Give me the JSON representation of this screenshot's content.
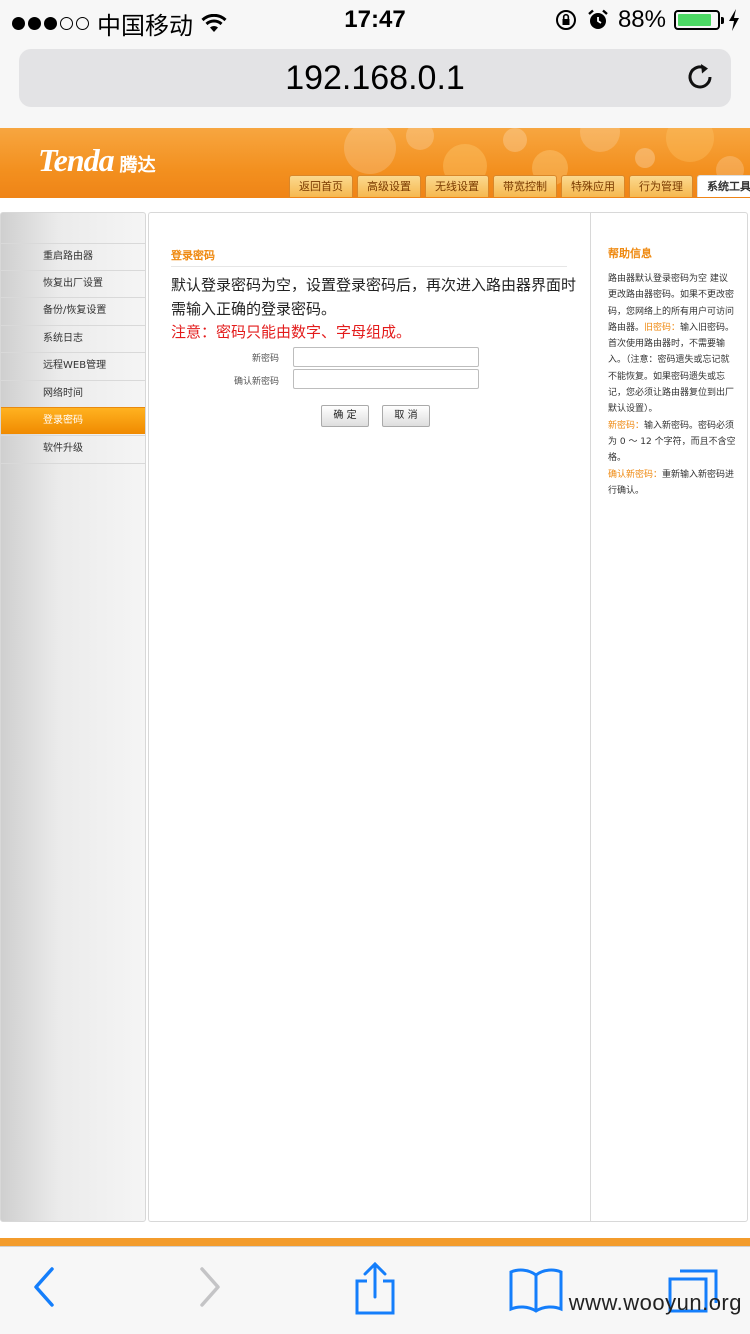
{
  "status_bar": {
    "carrier": "中国移动",
    "time": "17:47",
    "battery": "88%",
    "battery_level": 0.88
  },
  "browser": {
    "url": "192.168.0.1",
    "reload_icon": "reload-icon"
  },
  "header": {
    "logo_text": "Tenda",
    "logo_cn": "腾达",
    "tabs": [
      {
        "label": "返回首页"
      },
      {
        "label": "高级设置"
      },
      {
        "label": "无线设置"
      },
      {
        "label": "带宽控制"
      },
      {
        "label": "特殊应用"
      },
      {
        "label": "行为管理"
      },
      {
        "label": "系统工具"
      }
    ]
  },
  "sidebar": {
    "items": [
      {
        "label": "重启路由器"
      },
      {
        "label": "恢复出厂设置"
      },
      {
        "label": "备份/恢复设置"
      },
      {
        "label": "系统日志"
      },
      {
        "label": "远程WEB管理"
      },
      {
        "label": "网络时间"
      },
      {
        "label": "登录密码"
      },
      {
        "label": "软件升级"
      }
    ]
  },
  "main": {
    "title": "登录密码",
    "description": "默认登录密码为空，设置登录密码后，再次进入路由器界面时需输入正确的登录密码。",
    "note": "注意：密码只能由数字、字母组成。",
    "new_password_label": "新密码",
    "new_password_value": "",
    "confirm_password_label": "确认新密码",
    "confirm_password_value": "",
    "ok_label": "确 定",
    "cancel_label": "取 消"
  },
  "help": {
    "title": "帮助信息",
    "intro": "路由器默认登录密码为空 建议更改路由器密码。如果不更改密码，您网络上的所有用户可访问路由器。",
    "old_label": "旧密码：",
    "old_text": "输入旧密码。首次使用路由器时，不需要输入。（注意：密码遗失或忘记就不能恢复。如果密码遗失或忘记，您必须让路由器复位到出厂默认设置）。",
    "new_label": "新密码：",
    "new_text": "输入新密码。密码必须为 0 ～ 12 个字符，而且不含空格。",
    "confirm_label": "确认新密码：",
    "confirm_text": "重新输入新密码进行确认。"
  },
  "toolbar": {
    "back_icon": "back-icon",
    "forward_icon": "forward-icon",
    "share_icon": "share-icon",
    "bookmarks_icon": "bookmarks-icon",
    "tabs_icon": "tabs-icon"
  },
  "watermark": "www.wooyun.org",
  "colors": {
    "accent": "#f39c2c",
    "highlight": "#ef8a12",
    "note_red": "#e31b1b",
    "battery_green": "#4cd964",
    "ios_blue": "#147efb"
  }
}
